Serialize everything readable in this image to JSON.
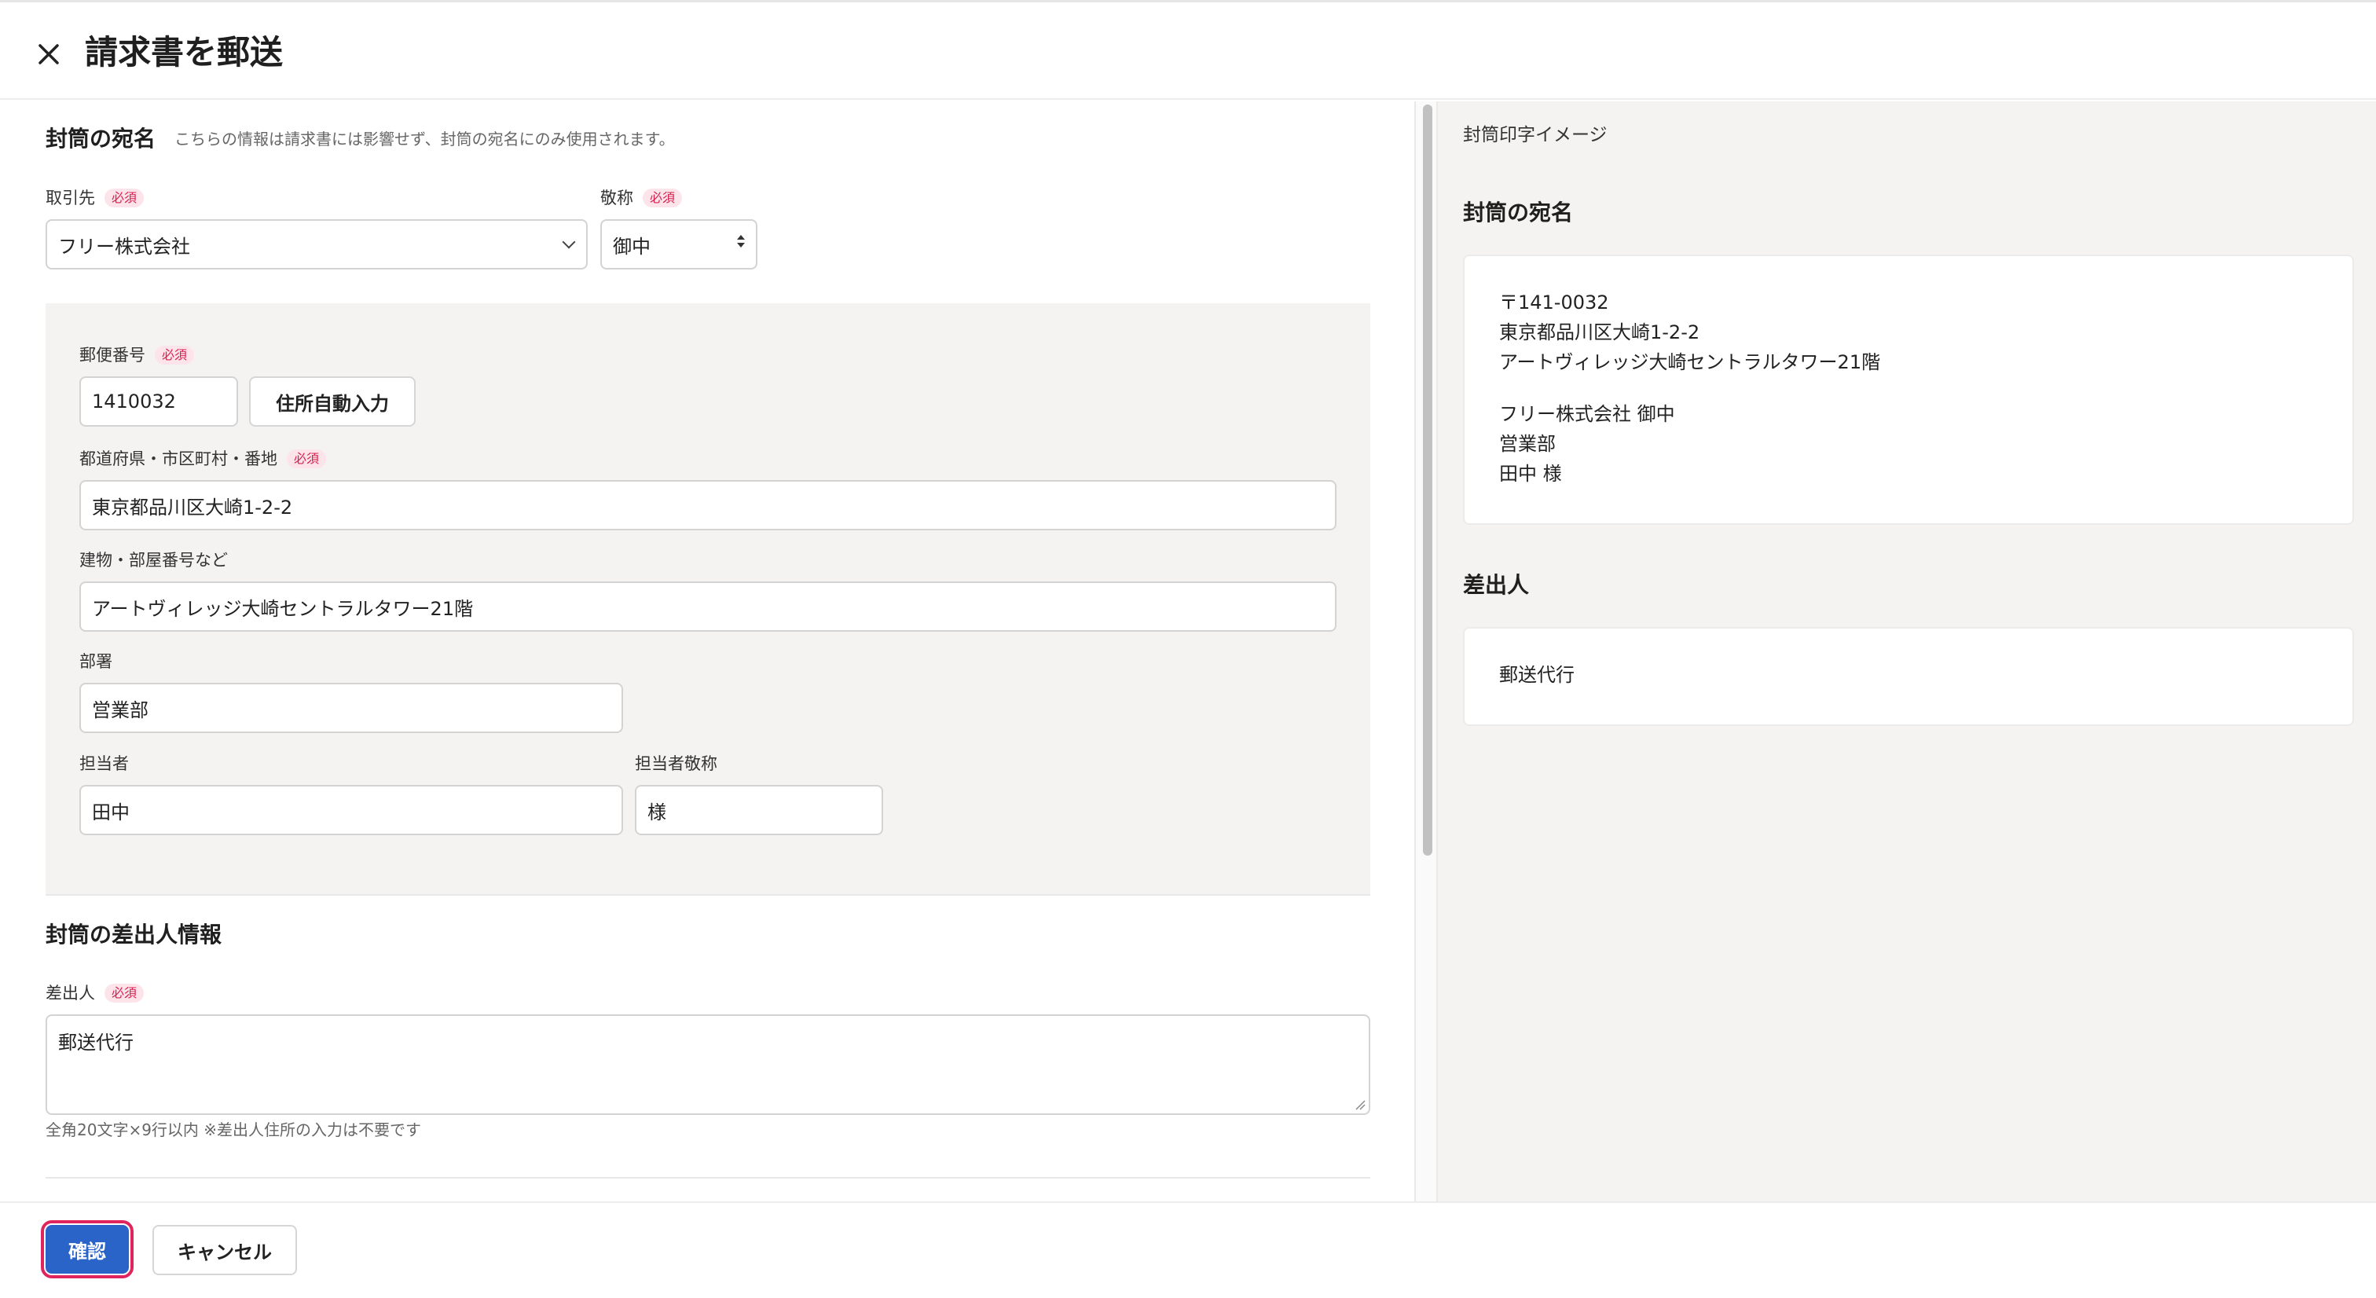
{
  "header": {
    "title": "請求書を郵送",
    "close_icon": "close-icon"
  },
  "recipient": {
    "section_title": "封筒の宛名",
    "section_note": "こちらの情報は請求書には影響せず、封筒の宛名にのみ使用されます。",
    "required_badge": "必須",
    "partner_label": "取引先",
    "partner_value": "フリー株式会社",
    "honorific_label": "敬称",
    "honorific_value": "御中",
    "postal_label": "郵便番号",
    "postal_value": "1410032",
    "autofill_button": "住所自動入力",
    "address_label": "都道府県・市区町村・番地",
    "address_value": "東京都品川区大崎1-2-2",
    "building_label": "建物・部屋番号など",
    "building_value": "アートヴィレッジ大崎セントラルタワー21階",
    "department_label": "部署",
    "department_value": "営業部",
    "person_label": "担当者",
    "person_value": "田中",
    "person_honorific_label": "担当者敬称",
    "person_honorific_value": "様"
  },
  "sender": {
    "section_title": "封筒の差出人情報",
    "label": "差出人",
    "value": "郵送代行",
    "hint": "全角20文字×9行以内 ※差出人住所の入力は不要です"
  },
  "preview": {
    "title": "封筒印字イメージ",
    "recipient_title": "封筒の宛名",
    "postal_line": "〒141-0032",
    "address_line": "東京都品川区大崎1-2-2",
    "building_line": "アートヴィレッジ大崎セントラルタワー21階",
    "company_line": "フリー株式会社 御中",
    "department_line": "営業部",
    "person_line": "田中 様",
    "sender_title": "差出人",
    "sender_line": "郵送代行"
  },
  "footer": {
    "confirm_label": "確認",
    "cancel_label": "キャンセル"
  },
  "colors": {
    "primary": "#2a64c8",
    "required": "#d6204e",
    "panel": "#f4f3f2"
  }
}
